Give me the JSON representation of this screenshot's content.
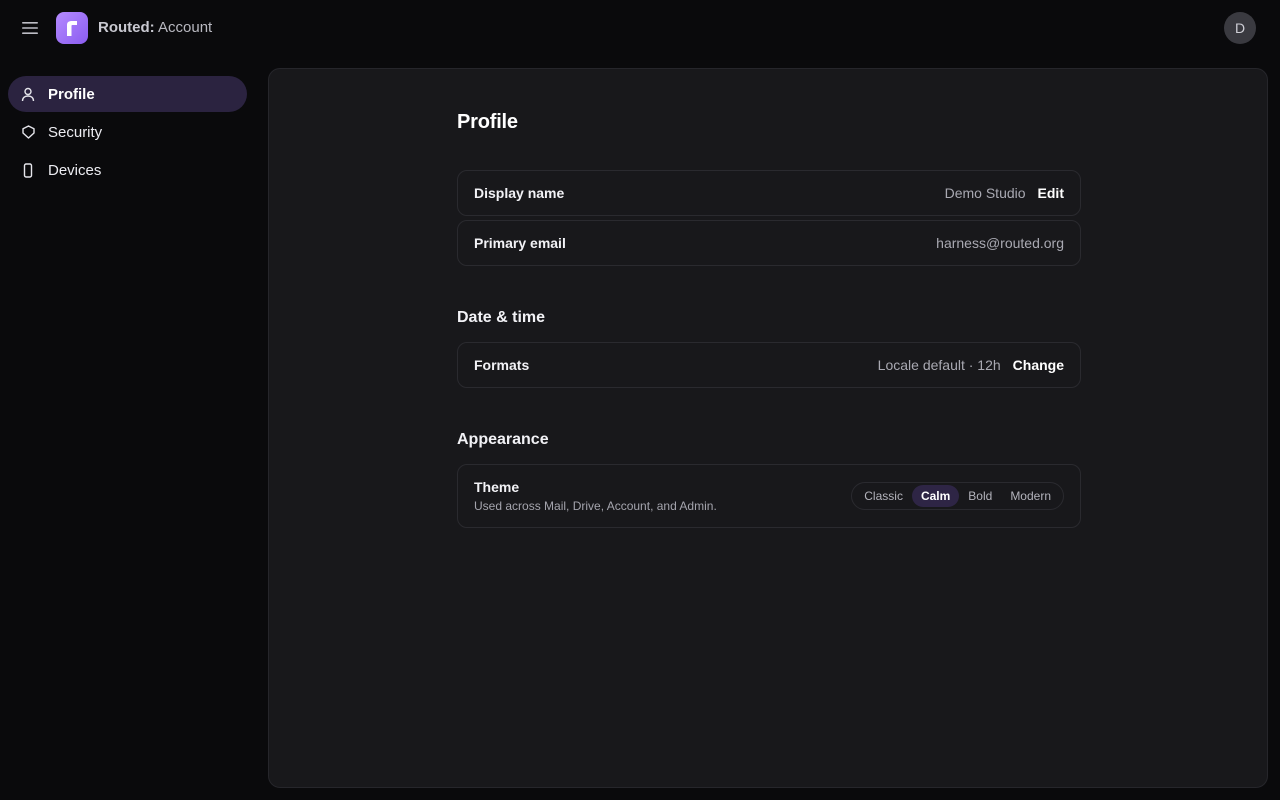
{
  "header": {
    "brand": "Routed:",
    "section": "Account",
    "logo_letter": "r",
    "avatar_initial": "D",
    "menu_icon": "hamburger-icon"
  },
  "sidebar": {
    "items": [
      {
        "label": "Profile",
        "icon": "user-icon",
        "active": true
      },
      {
        "label": "Security",
        "icon": "shield-icon",
        "active": false
      },
      {
        "label": "Devices",
        "icon": "phone-icon",
        "active": false
      }
    ]
  },
  "main": {
    "title": "Profile",
    "profile_rows": [
      {
        "label": "Display name",
        "value": "Demo Studio",
        "action": "Edit"
      },
      {
        "label": "Primary email",
        "value": "harness@routed.org",
        "action": ""
      }
    ],
    "datetime": {
      "title": "Date & time",
      "row": {
        "label": "Formats",
        "value": "Locale default · 12h",
        "action": "Change"
      }
    },
    "appearance": {
      "title": "Appearance",
      "row": {
        "label": "Theme",
        "sublabel": "Used across Mail, Drive, Account, and Admin.",
        "options": [
          "Classic",
          "Calm",
          "Bold",
          "Modern"
        ],
        "selected": "Calm"
      }
    }
  },
  "colors": {
    "accent": "#9b6cf5",
    "active_nav_bg": "#2b2340",
    "panel_bg": "#18181b",
    "page_bg": "#0a0a0c"
  }
}
